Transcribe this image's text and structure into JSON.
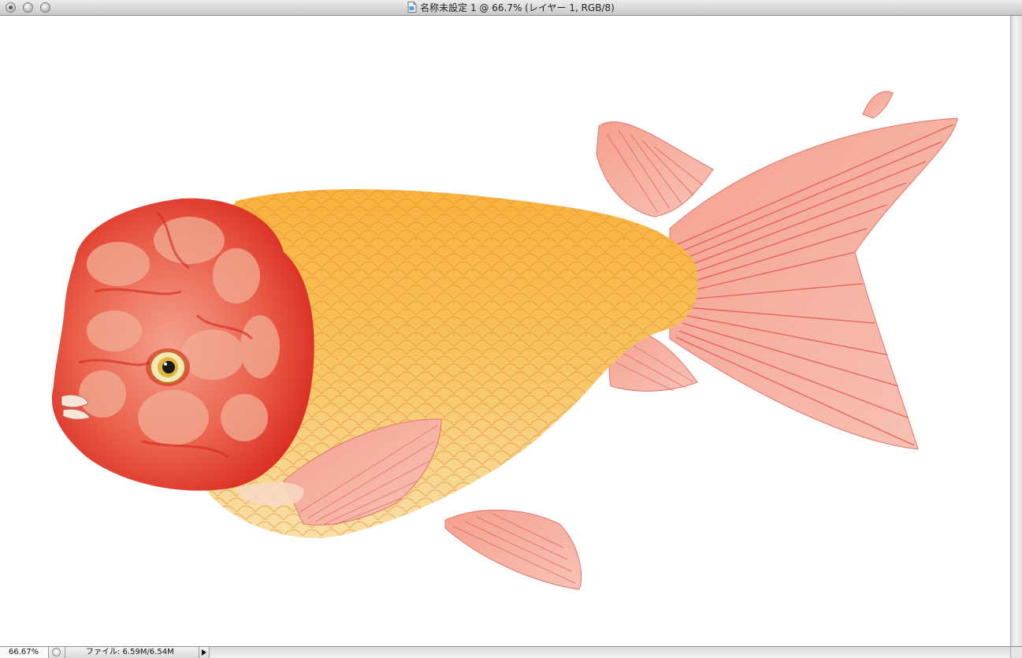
{
  "window": {
    "title": "名称未設定 1 @ 66.7% (レイヤー 1, RGB/8)"
  },
  "status": {
    "zoom": "66.67%",
    "file_info": "ファイル: 6.59M/6.54M"
  },
  "colors": {
    "canvas": "#ffffff",
    "fish_body": "#f6b64a",
    "fish_head": "#e0322a",
    "fish_fin": "#f27f73"
  },
  "icons": [
    "document-icon",
    "status-menu-icon",
    "status-arrow-icon"
  ]
}
